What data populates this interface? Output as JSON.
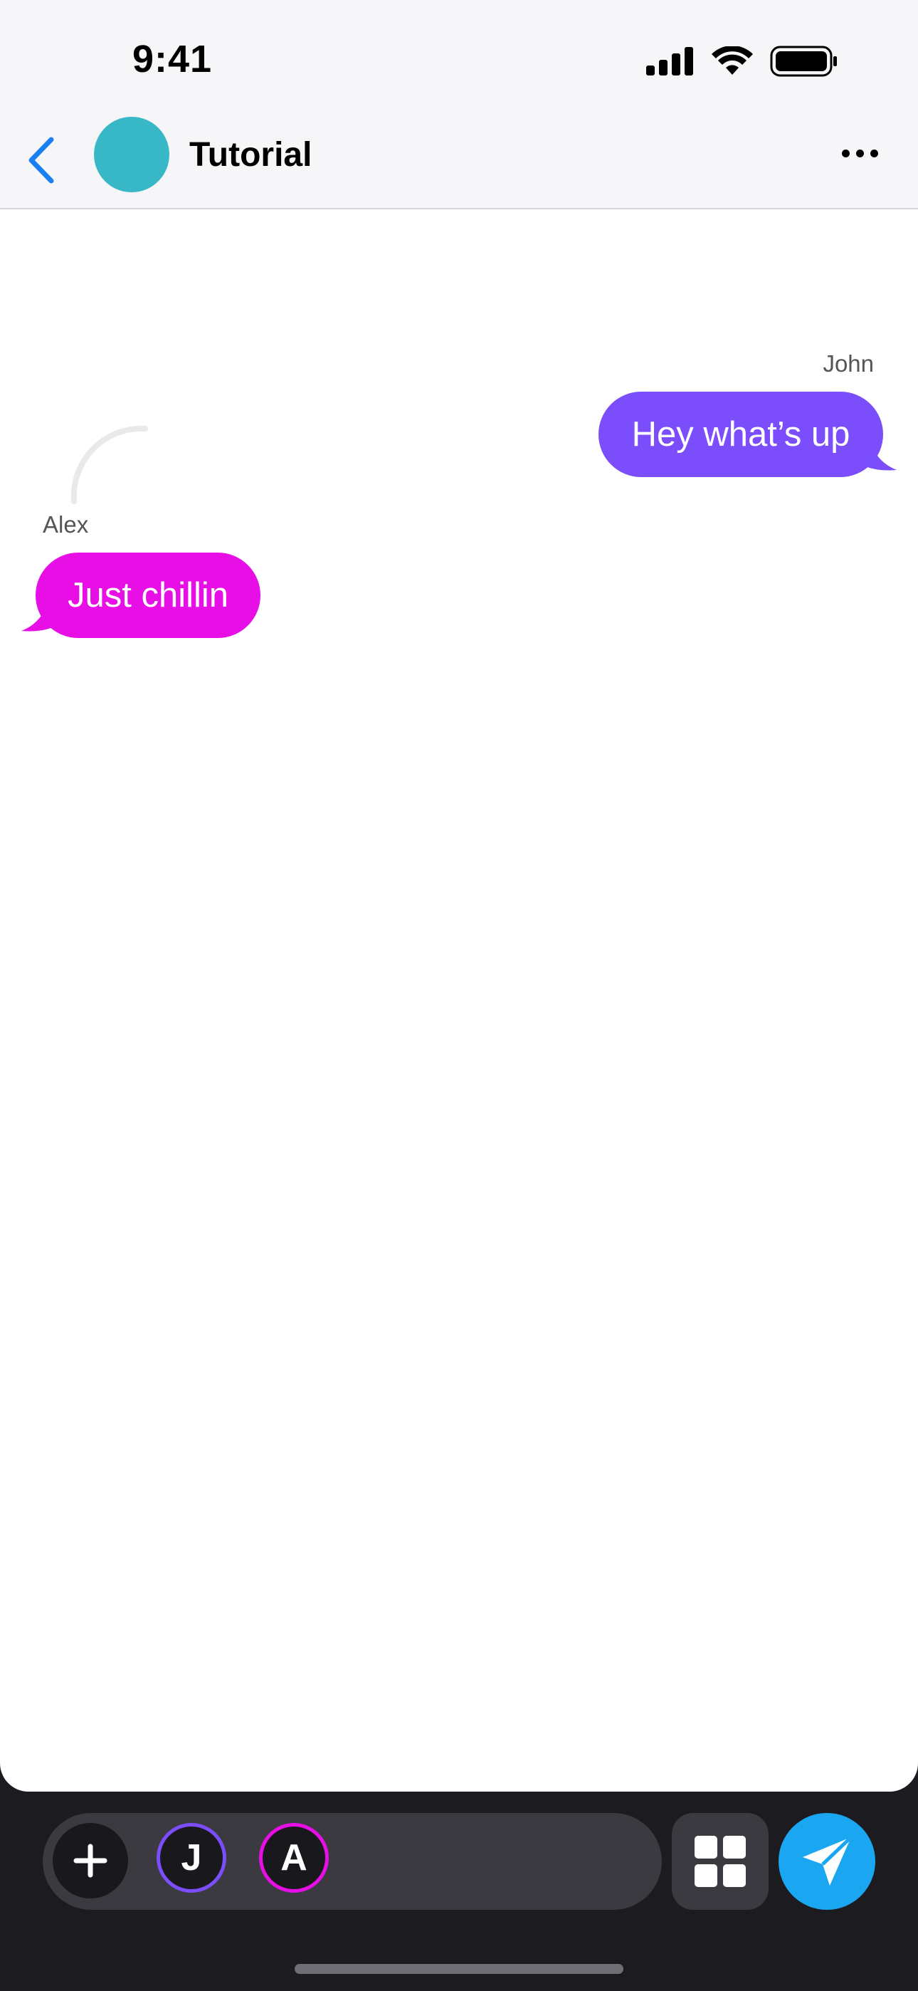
{
  "status_bar": {
    "time": "9:41"
  },
  "header": {
    "title": "Tutorial",
    "avatar_color": "#38b8c6"
  },
  "messages": [
    {
      "sender": "John",
      "text": "Hey what’s up",
      "side": "right",
      "color": "#7b4dfb"
    },
    {
      "sender": "Alex",
      "text": "Just chillin",
      "side": "left",
      "color": "#e70fe6"
    }
  ],
  "composer": {
    "participants": [
      {
        "initial": "J",
        "color": "#7b4dfb"
      },
      {
        "initial": "A",
        "color": "#e70fe6"
      }
    ],
    "send_color": "#1aa6f0"
  },
  "icons": {
    "back": "chevron-left-icon",
    "more": "ellipsis-icon",
    "add": "plus-icon",
    "grid": "grid-icon",
    "send": "send-icon"
  }
}
